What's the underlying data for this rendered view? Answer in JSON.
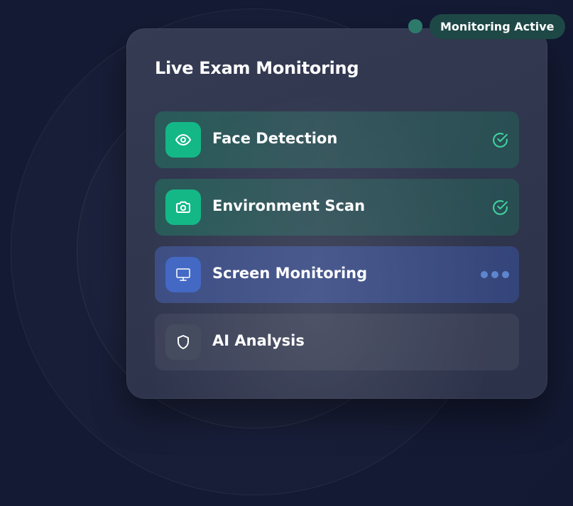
{
  "card": {
    "title": "Live Exam Monitoring"
  },
  "status_badge": {
    "label": "Monitoring Active",
    "dot_color": "#2d7a6a"
  },
  "checks": [
    {
      "label": "Face Detection",
      "icon": "eye-icon",
      "state": "done",
      "status_icon": "check-circle-icon"
    },
    {
      "label": "Environment Scan",
      "icon": "camera-icon",
      "state": "done",
      "status_icon": "check-circle-icon"
    },
    {
      "label": "Screen Monitoring",
      "icon": "monitor-icon",
      "state": "in-progress",
      "status_icon": "loading-dots-icon"
    },
    {
      "label": "AI Analysis",
      "icon": "shield-icon",
      "state": "pending",
      "status_icon": ""
    }
  ],
  "colors": {
    "success": "#14b887",
    "check": "#3fd1a0",
    "active": "#4369c4",
    "dots": "#5e86cf",
    "pending": "#464c5f",
    "background": "#141a33",
    "card": "#32384f"
  }
}
